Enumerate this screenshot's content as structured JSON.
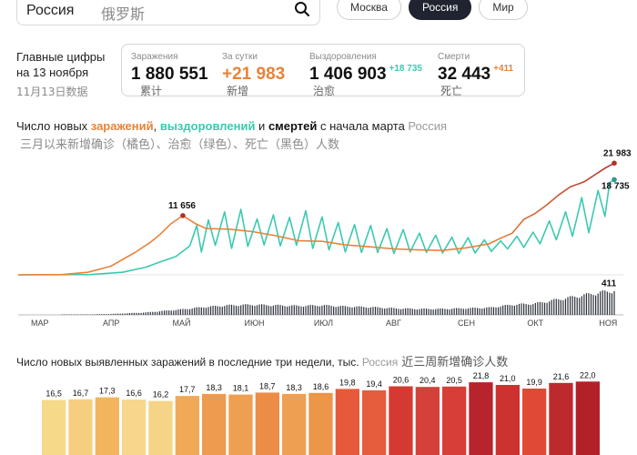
{
  "search": {
    "value": "Россия",
    "annotation": "俄罗斯",
    "icon": "search-icon"
  },
  "tabs": [
    {
      "label": "Москва",
      "active": false
    },
    {
      "label": "Россия",
      "active": true
    },
    {
      "label": "Мир",
      "active": false
    }
  ],
  "key_figures": {
    "heading_line1": "Главные цифры",
    "heading_line2": "на 13 ноября",
    "date_annotation": "11月13日数据",
    "stats": [
      {
        "label": "Заражения",
        "value": "1 880 551",
        "delta": "",
        "annotation": "累计"
      },
      {
        "label": "За сутки",
        "value": "+21 983",
        "delta": "",
        "annotation": "新增"
      },
      {
        "label": "Выздоровления",
        "value": "1 406 903",
        "delta": "+18 735",
        "annotation": "治愈"
      },
      {
        "label": "Смерти",
        "value": "32 443",
        "delta": "+411",
        "annotation": "死亡"
      }
    ],
    "colors": {
      "orange": "#e8833a",
      "green": "#3cc9b0",
      "dark": "#111111"
    }
  },
  "main_chart": {
    "title_parts": [
      "Число новых ",
      "заражений",
      ", ",
      "выздоровлений",
      " и ",
      "смертей",
      " с начала марта "
    ],
    "region": "Россия",
    "annotation": "三月以来新增确诊（橘色）、治愈（绿色）、死亡（黑色）人数"
  },
  "bar_section": {
    "title": "Число новых выявленных заражений в последние три недели, тыс.",
    "region": "Россия",
    "annotation": "近三周新增确诊人数"
  },
  "chart_data": [
    {
      "type": "line",
      "x_ticks": [
        "МАР",
        "АПР",
        "МАЙ",
        "ИЮН",
        "ИЮЛ",
        "АВГ",
        "СЕН",
        "ОКТ",
        "НОЯ"
      ],
      "x_range": [
        "2020-03-01",
        "2020-11-13"
      ],
      "y_range": [
        0,
        24000
      ],
      "series": [
        {
          "key": "infections",
          "color": "#e8833a",
          "peak_color": "#b0302a",
          "points": [
            [
              "2020-03-01",
              0
            ],
            [
              "2020-03-20",
              50
            ],
            [
              "2020-03-31",
              500
            ],
            [
              "2020-04-10",
              1700
            ],
            [
              "2020-04-20",
              4300
            ],
            [
              "2020-04-27",
              6400
            ],
            [
              "2020-05-01",
              7900
            ],
            [
              "2020-05-06",
              10100
            ],
            [
              "2020-05-11",
              11656
            ],
            [
              "2020-05-16",
              10200
            ],
            [
              "2020-05-21",
              9100
            ],
            [
              "2020-05-31",
              9000
            ],
            [
              "2020-06-10",
              8500
            ],
            [
              "2020-06-20",
              7700
            ],
            [
              "2020-06-30",
              6700
            ],
            [
              "2020-07-10",
              6600
            ],
            [
              "2020-07-20",
              5900
            ],
            [
              "2020-07-31",
              5500
            ],
            [
              "2020-08-10",
              5100
            ],
            [
              "2020-08-20",
              4900
            ],
            [
              "2020-08-31",
              4800
            ],
            [
              "2020-09-10",
              5300
            ],
            [
              "2020-09-20",
              6100
            ],
            [
              "2020-09-25",
              7200
            ],
            [
              "2020-09-30",
              8200
            ],
            [
              "2020-10-05",
              10900
            ],
            [
              "2020-10-10",
              12100
            ],
            [
              "2020-10-15",
              13800
            ],
            [
              "2020-10-20",
              15700
            ],
            [
              "2020-10-25",
              17300
            ],
            [
              "2020-10-31",
              18300
            ],
            [
              "2020-11-05",
              19800
            ],
            [
              "2020-11-09",
              21000
            ],
            [
              "2020-11-13",
              21983
            ]
          ],
          "end_label": "21 983",
          "peak_label": "11 656",
          "peak_date": "2020-05-11"
        },
        {
          "key": "recoveries",
          "color": "#3cc9b0",
          "points": [
            [
              "2020-03-01",
              0
            ],
            [
              "2020-04-01",
              50
            ],
            [
              "2020-04-15",
              500
            ],
            [
              "2020-04-25",
              1500
            ],
            [
              "2020-05-01",
              2500
            ],
            [
              "2020-05-08",
              3600
            ],
            [
              "2020-05-14",
              5700
            ],
            [
              "2020-05-17",
              9700
            ],
            [
              "2020-05-19",
              4500
            ],
            [
              "2020-05-22",
              10800
            ],
            [
              "2020-05-25",
              5800
            ],
            [
              "2020-05-29",
              12400
            ],
            [
              "2020-06-01",
              5200
            ],
            [
              "2020-06-05",
              12900
            ],
            [
              "2020-06-08",
              5600
            ],
            [
              "2020-06-12",
              11000
            ],
            [
              "2020-06-15",
              5900
            ],
            [
              "2020-06-19",
              11800
            ],
            [
              "2020-06-22",
              5700
            ],
            [
              "2020-06-26",
              11300
            ],
            [
              "2020-06-29",
              5800
            ],
            [
              "2020-07-03",
              12600
            ],
            [
              "2020-07-06",
              5200
            ],
            [
              "2020-07-10",
              11400
            ],
            [
              "2020-07-13",
              4900
            ],
            [
              "2020-07-17",
              10300
            ],
            [
              "2020-07-20",
              4500
            ],
            [
              "2020-07-24",
              9900
            ],
            [
              "2020-07-27",
              4400
            ],
            [
              "2020-07-31",
              9700
            ],
            [
              "2020-08-03",
              4400
            ],
            [
              "2020-08-07",
              9100
            ],
            [
              "2020-08-10",
              4200
            ],
            [
              "2020-08-14",
              8900
            ],
            [
              "2020-08-17",
              4500
            ],
            [
              "2020-08-21",
              8200
            ],
            [
              "2020-08-24",
              4400
            ],
            [
              "2020-08-28",
              7800
            ],
            [
              "2020-08-31",
              4300
            ],
            [
              "2020-09-04",
              7400
            ],
            [
              "2020-09-07",
              4200
            ],
            [
              "2020-09-11",
              7300
            ],
            [
              "2020-09-14",
              4300
            ],
            [
              "2020-09-18",
              6900
            ],
            [
              "2020-09-21",
              4600
            ],
            [
              "2020-09-25",
              6700
            ],
            [
              "2020-09-28",
              5100
            ],
            [
              "2020-10-02",
              7600
            ],
            [
              "2020-10-05",
              5400
            ],
            [
              "2020-10-09",
              8400
            ],
            [
              "2020-10-12",
              6100
            ],
            [
              "2020-10-16",
              10600
            ],
            [
              "2020-10-19",
              6900
            ],
            [
              "2020-10-23",
              12400
            ],
            [
              "2020-10-26",
              7600
            ],
            [
              "2020-10-30",
              15200
            ],
            [
              "2020-11-02",
              8300
            ],
            [
              "2020-11-06",
              16600
            ],
            [
              "2020-11-09",
              11500
            ],
            [
              "2020-11-11",
              18100
            ],
            [
              "2020-11-13",
              18735
            ]
          ],
          "end_label": "18 735"
        }
      ],
      "deaths_bars": {
        "color": "#2b2f3a",
        "points": [
          [
            "2020-03-25",
            2
          ],
          [
            "2020-04-10",
            15
          ],
          [
            "2020-04-25",
            40
          ],
          [
            "2020-05-10",
            90
          ],
          [
            "2020-05-20",
            130
          ],
          [
            "2020-05-31",
            160
          ],
          [
            "2020-06-10",
            170
          ],
          [
            "2020-06-20",
            160
          ],
          [
            "2020-06-30",
            150
          ],
          [
            "2020-07-10",
            160
          ],
          [
            "2020-07-20",
            140
          ],
          [
            "2020-07-31",
            130
          ],
          [
            "2020-08-10",
            110
          ],
          [
            "2020-08-20",
            100
          ],
          [
            "2020-08-31",
            100
          ],
          [
            "2020-09-10",
            110
          ],
          [
            "2020-09-20",
            120
          ],
          [
            "2020-09-30",
            170
          ],
          [
            "2020-10-10",
            190
          ],
          [
            "2020-10-20",
            260
          ],
          [
            "2020-10-31",
            330
          ],
          [
            "2020-11-06",
            370
          ],
          [
            "2020-11-10",
            390
          ],
          [
            "2020-11-13",
            411
          ]
        ],
        "end_label": "411",
        "y_range": [
          0,
          450
        ]
      }
    },
    {
      "type": "bar",
      "ylabel": "тыс.",
      "ylim": [
        0,
        24
      ],
      "values": [
        16.5,
        16.7,
        17.3,
        16.6,
        16.2,
        17.7,
        18.3,
        18.1,
        18.7,
        18.3,
        18.6,
        19.8,
        19.4,
        20.6,
        20.4,
        20.5,
        21.8,
        21.0,
        19.9,
        21.6,
        22.0
      ],
      "labels": [
        "16,5",
        "16,7",
        "17,3",
        "16,6",
        "16,2",
        "17,7",
        "18,3",
        "18,1",
        "18,7",
        "18,3",
        "18,6",
        "19,8",
        "19,4",
        "20,6",
        "20,4",
        "20,5",
        "21,8",
        "21,0",
        "19,9",
        "21,6",
        "22,0"
      ],
      "colors": [
        "#f7d98a",
        "#f5cf7f",
        "#f2b55e",
        "#f6d78b",
        "#f5d487",
        "#f1a957",
        "#ee9b4f",
        "#ef9f51",
        "#eb8d47",
        "#ef9f51",
        "#ec9649",
        "#e65a3b",
        "#e55d3c",
        "#d43a32",
        "#d6403a",
        "#d63e38",
        "#b8242c",
        "#cc3230",
        "#df4a36",
        "#bd2a2e",
        "#b32128"
      ]
    }
  ]
}
